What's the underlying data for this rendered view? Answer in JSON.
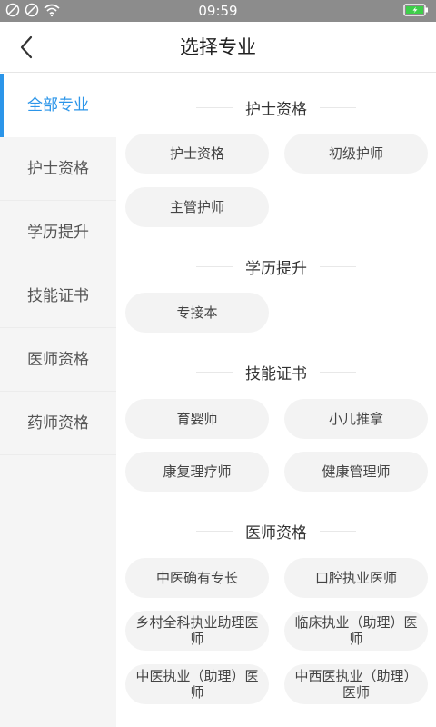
{
  "status_bar": {
    "time": "09:59"
  },
  "header": {
    "title": "选择专业"
  },
  "sidebar": {
    "items": [
      {
        "label": "全部专业"
      },
      {
        "label": "护士资格"
      },
      {
        "label": "学历提升"
      },
      {
        "label": "技能证书"
      },
      {
        "label": "医师资格"
      },
      {
        "label": "药师资格"
      }
    ]
  },
  "sections": [
    {
      "title": "护士资格",
      "items": [
        "护士资格",
        "初级护师",
        "主管护师"
      ]
    },
    {
      "title": "学历提升",
      "items": [
        "专接本"
      ]
    },
    {
      "title": "技能证书",
      "items": [
        "育婴师",
        "小儿推拿",
        "康复理疗师",
        "健康管理师"
      ]
    },
    {
      "title": "医师资格",
      "items": [
        "中医确有专长",
        "口腔执业医师",
        "乡村全科执业助理医师",
        "临床执业（助理）医师",
        "中医执业（助理）医师",
        "中西医执业（助理）医师"
      ]
    }
  ]
}
